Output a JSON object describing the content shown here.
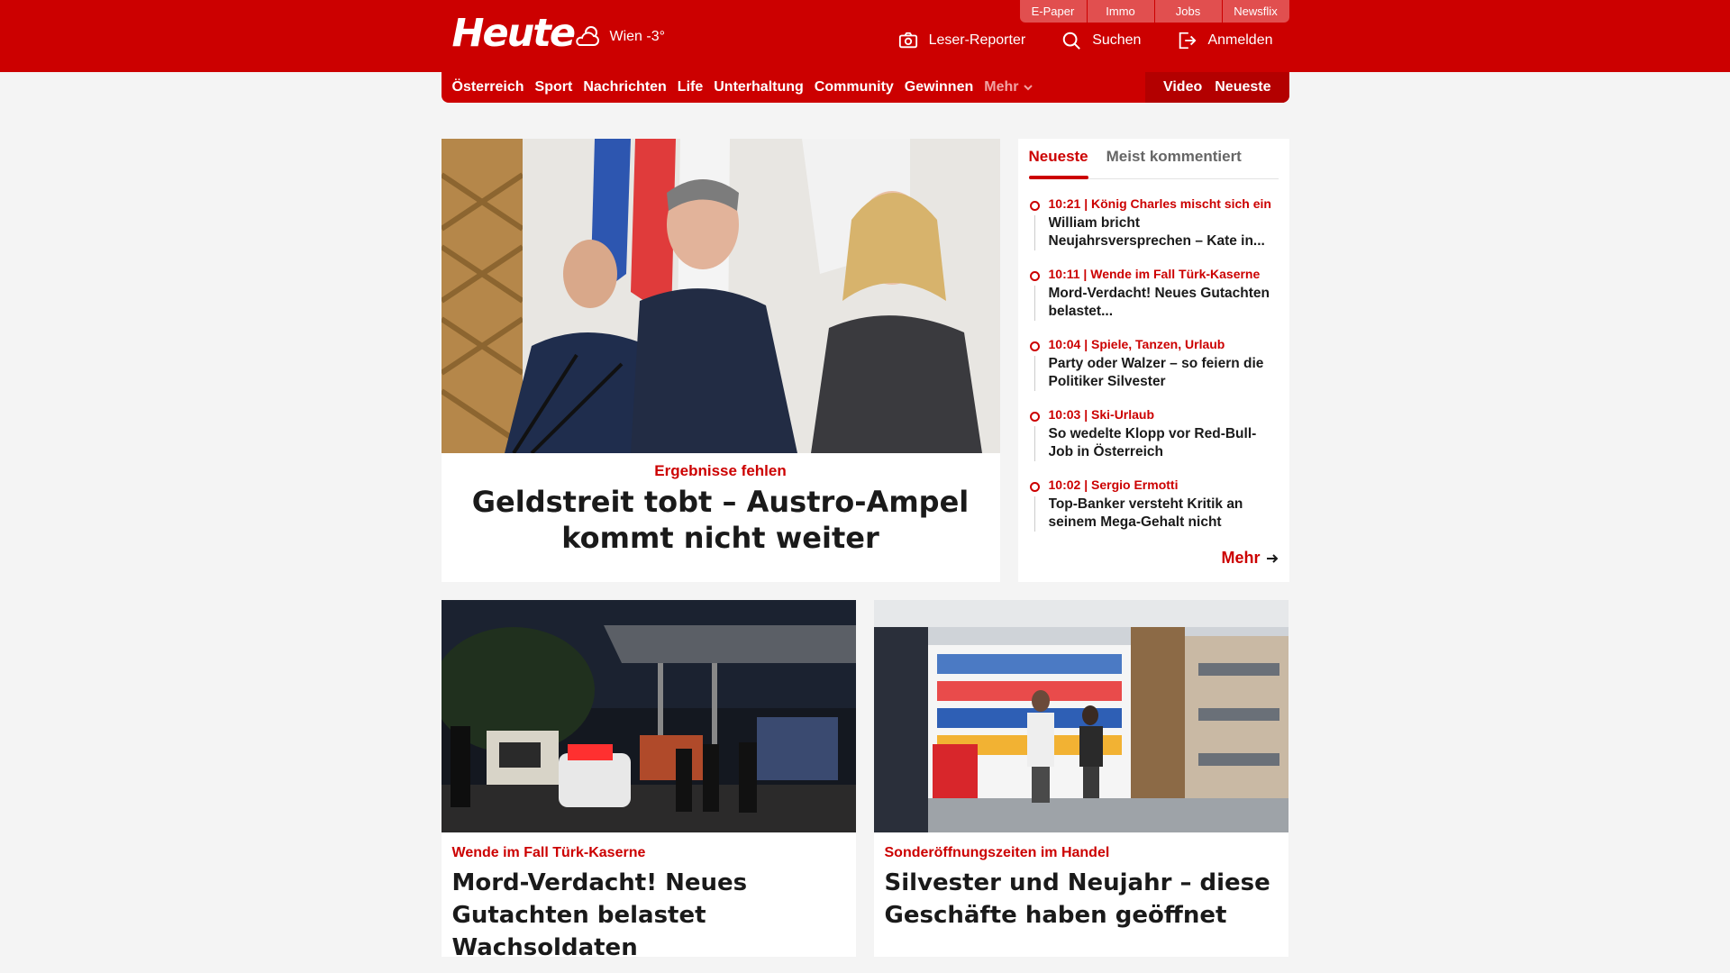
{
  "header": {
    "logo": "Heute",
    "weather": "Wien -3°",
    "top_links": [
      "E-Paper",
      "Immo",
      "Jobs",
      "Newsflix"
    ],
    "actions": [
      {
        "label": "Leser-Reporter",
        "icon": "camera-icon"
      },
      {
        "label": "Suchen",
        "icon": "search-icon"
      },
      {
        "label": "Anmelden",
        "icon": "login-icon"
      }
    ]
  },
  "nav": {
    "items": [
      "Österreich",
      "Sport",
      "Nachrichten",
      "Life",
      "Unterhaltung",
      "Community",
      "Gewinnen"
    ],
    "more": "Mehr",
    "right": [
      "Video",
      "Neueste"
    ]
  },
  "hero": {
    "kicker": "Ergebnisse fehlen",
    "title": "Geldstreit tobt – Austro-Ampel kommt nicht weiter"
  },
  "sidebar": {
    "tabs": [
      "Neueste",
      "Meist kommentiert"
    ],
    "items": [
      {
        "time": "10:21",
        "topic": "König Charles mischt sich ein",
        "title": "William bricht Neujahrsversprechen – Kate in..."
      },
      {
        "time": "10:11",
        "topic": "Wende im Fall Türk-Kaserne",
        "title": "Mord-Verdacht! Neues Gutachten belastet..."
      },
      {
        "time": "10:04",
        "topic": "Spiele, Tanzen, Urlaub",
        "title": "Party oder Walzer – so feiern die Politiker Silvester"
      },
      {
        "time": "10:03",
        "topic": "Ski-Urlaub",
        "title": "So wedelte Klopp vor Red-Bull-Job in Österreich"
      },
      {
        "time": "10:02",
        "topic": "Sergio Ermotti",
        "title": "Top-Banker versteht Kritik an seinem Mega-Gehalt nicht"
      }
    ],
    "more": "Mehr"
  },
  "cards": [
    {
      "kicker": "Wende im Fall Türk-Kaserne",
      "title": "Mord-Verdacht! Neues Gutachten belastet Wachsoldaten"
    },
    {
      "kicker": "Sonderöffnungszeiten im Handel",
      "title": "Silvester und Neujahr – diese Geschäfte haben geöffnet"
    }
  ],
  "colors": {
    "brand": "#cc0000",
    "background": "#f4f4f4"
  }
}
